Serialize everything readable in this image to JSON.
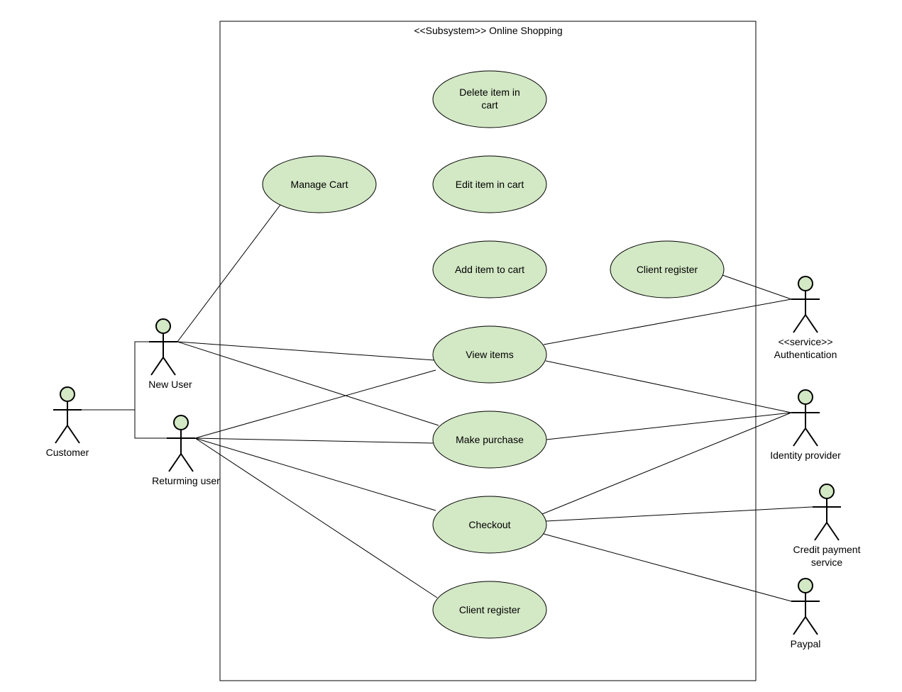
{
  "system": {
    "title": "<<Subsystem>> Online Shopping"
  },
  "actors": {
    "customer": "Customer",
    "newUser": "New User",
    "returningUser": "Returming user",
    "authLine1": "<<service>>",
    "authLine2": "Authentication",
    "identity": "Identity provider",
    "creditLine1": "Credit payment",
    "creditLine2": "service",
    "paypal": "Paypal"
  },
  "usecases": {
    "deleteItemLine1": "Delete item in",
    "deleteItemLine2": "cart",
    "editItem": "Edit item in cart",
    "addItem": "Add item to cart",
    "manageCart": "Manage Cart",
    "clientRegisterTop": "Client register",
    "viewItems": "View items",
    "makePurchase": "Make purchase",
    "checkout": "Checkout",
    "clientRegisterBottom": "Client register"
  }
}
